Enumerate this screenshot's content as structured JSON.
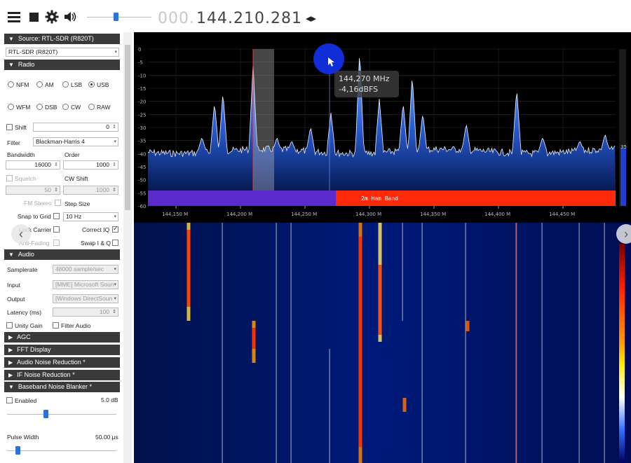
{
  "toolbar": {
    "menu_icon": "hamburger-menu-icon",
    "stop_icon": "stop-icon",
    "settings_icon": "gear-icon",
    "volume_icon": "speaker-icon",
    "freq_dim": "000.",
    "freq_main": "144.210.281",
    "freq_arrows": "◂▸"
  },
  "panel": {
    "source": {
      "header": "Source: RTL-SDR (R820T)",
      "device": "RTL-SDR (R820T)"
    },
    "radio": {
      "header": "Radio",
      "modes": [
        "NFM",
        "AM",
        "LSB",
        "USB",
        "WFM",
        "DSB",
        "CW",
        "RAW"
      ],
      "selected_mode": "USB",
      "shift_label": "Shift",
      "shift_value": "0",
      "filter_label": "Filter",
      "filter_value": "Blackman-Harris 4",
      "bandwidth_label": "Bandwidth",
      "bandwidth_value": "16000",
      "order_label": "Order",
      "order_value": "1000",
      "squelch_label": "Squelch",
      "squelch_value": "50",
      "cw_shift_label": "CW Shift",
      "cw_shift_value": "1000",
      "fm_stereo_label": "FM Stereo",
      "step_size_label": "Step Size",
      "snap_label": "Snap to Grid",
      "step_value": "10 Hz",
      "lock_carrier_label": "Lock Carrier",
      "correct_iq_label": "Correct IQ",
      "anti_fading_label": "Anti-Fading",
      "swap_iq_label": "Swap I & Q"
    },
    "audio": {
      "header": "Audio",
      "samplerate_label": "Samplerate",
      "samplerate_value": "48000 sample/sec",
      "input_label": "Input",
      "input_value": "[MME] Microsoft Soun",
      "output_label": "Output",
      "output_value": "[Windows DirectSoun",
      "latency_label": "Latency (ms)",
      "latency_value": "100",
      "unity_gain_label": "Unity Gain",
      "filter_audio_label": "Filter Audio"
    },
    "collapsed": [
      "AGC",
      "FFT Display",
      "Audio Noise Reduction *",
      "IF Noise Reduction *"
    ],
    "noise_blanker": {
      "header": "Baseband Noise Blanker *",
      "enabled_label": "Enabled",
      "threshold_value": "5.0 dB",
      "pulse_width_label": "Pulse Width",
      "pulse_width_value": "50.00 µs"
    }
  },
  "spectrum": {
    "y_ticks": [
      "0",
      "-5",
      "-10",
      "-15",
      "-20",
      "-25",
      "-30",
      "-35",
      "-40",
      "-45",
      "-50",
      "-55",
      "-60"
    ],
    "x_ticks": [
      "144,150 M",
      "144,200 M",
      "144,250 M",
      "144,300 M",
      "144,350 M",
      "144,400 M",
      "144,450 M"
    ],
    "band_label": "2m Ham Band",
    "tooltip_freq": "144,270 MHz",
    "tooltip_level": "-4,16dBFS",
    "side_value": "35"
  },
  "colors": {
    "header_bg": "#3a3a3a",
    "accent": "#2b74d6",
    "band_red": "#ff2a0a",
    "band_purple": "#5a2acc"
  }
}
